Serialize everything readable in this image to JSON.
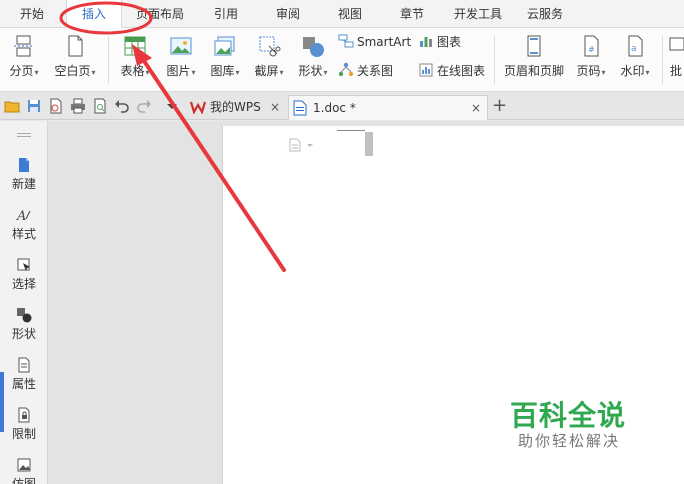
{
  "menu": {
    "tabs": [
      {
        "label": "开始"
      },
      {
        "label": "插入"
      },
      {
        "label": "页面布局"
      },
      {
        "label": "引用"
      },
      {
        "label": "审阅"
      },
      {
        "label": "视图"
      },
      {
        "label": "章节"
      },
      {
        "label": "开发工具"
      },
      {
        "label": "云服务"
      }
    ],
    "active": "插入"
  },
  "ribbon": {
    "page_break": "分页",
    "blank_page": "空白页",
    "table": "表格",
    "picture": "图片",
    "gallery": "图库",
    "screenshot": "截屏",
    "shapes": "形状",
    "smartart": "SmartArt",
    "chart": "图表",
    "relation": "关系图",
    "online_chart": "在线图表",
    "header_footer": "页眉和页脚",
    "page_number": "页码",
    "watermark": "水印",
    "comment": "批"
  },
  "tabs": {
    "wps_home": "我的WPS",
    "doc": "1.doc *",
    "close": "×",
    "new": "+"
  },
  "sidebar": {
    "items": [
      {
        "label": "新建"
      },
      {
        "label": "样式"
      },
      {
        "label": "选择"
      },
      {
        "label": "形状"
      },
      {
        "label": "属性"
      },
      {
        "label": "限制"
      },
      {
        "label": "仿图"
      }
    ]
  },
  "watermark": {
    "title": "百科全说",
    "subtitle": "助你轻松解决"
  },
  "colors": {
    "accent": "#2b6cc4",
    "annotation": "#e8383d",
    "watermark_green": "#2fa84f"
  }
}
